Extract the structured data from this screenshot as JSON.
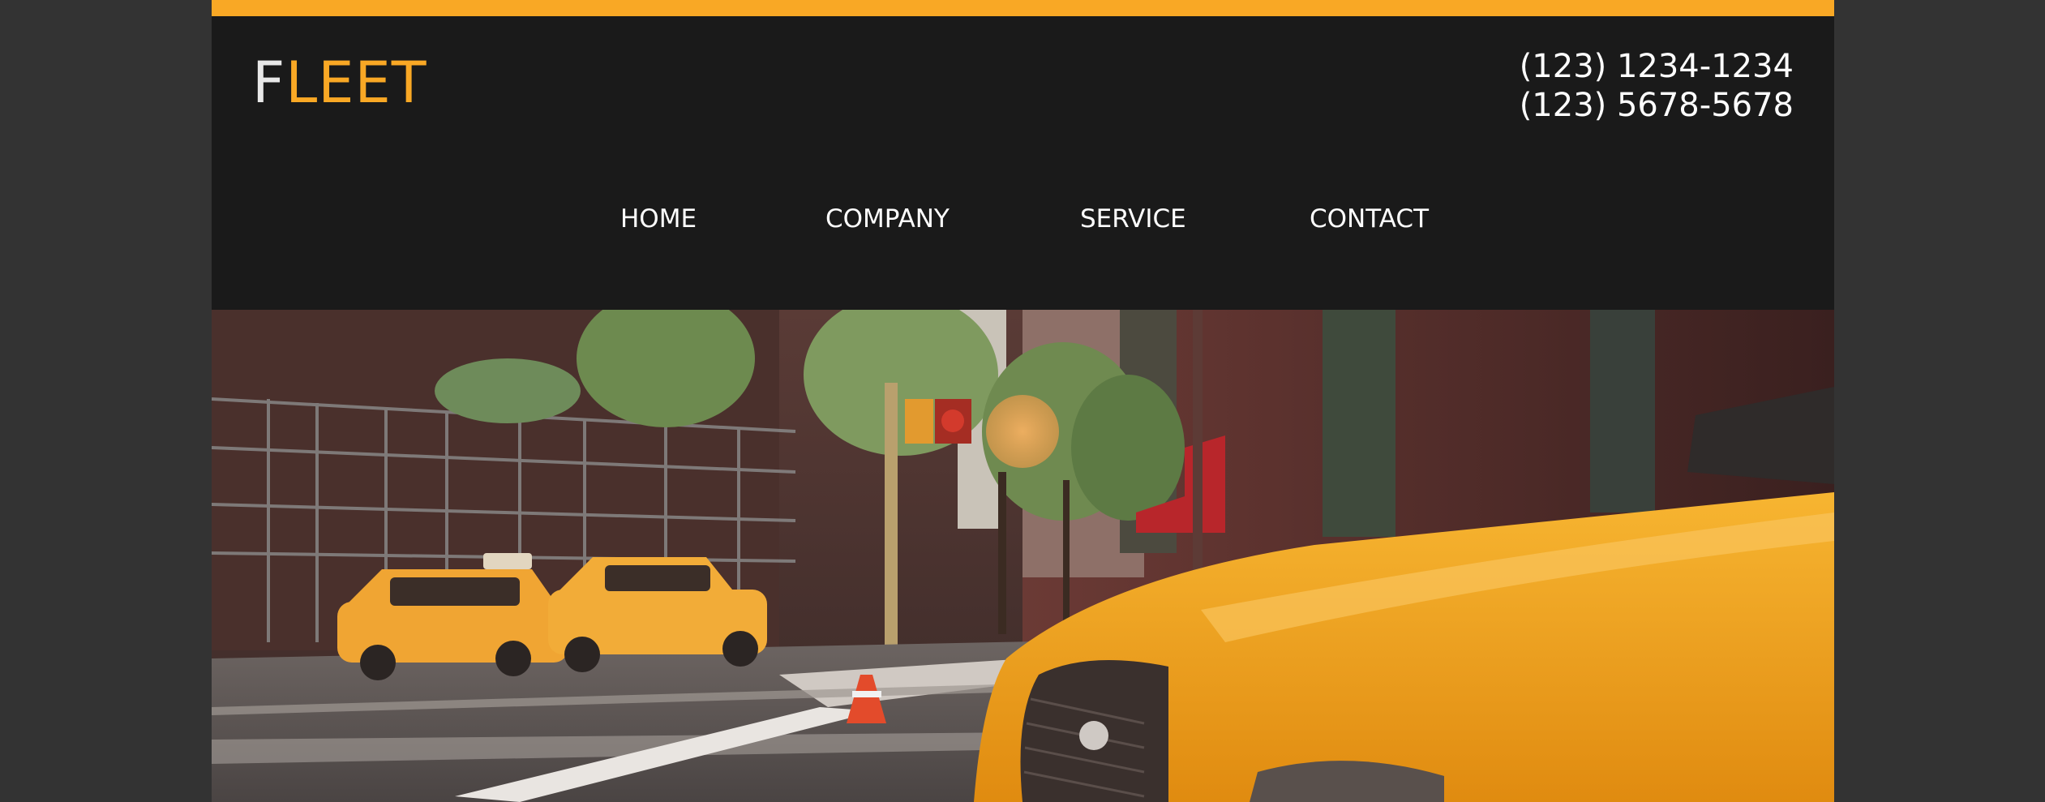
{
  "brand": {
    "first_letter": "F",
    "rest": "LEET",
    "accent_color": "#f9a825",
    "first_letter_color": "#e8e8e8"
  },
  "contact": {
    "phone_1": "(123) 1234-1234",
    "phone_2": "(123) 5678-5678"
  },
  "nav": {
    "items": [
      {
        "label": "HOME"
      },
      {
        "label": "COMPANY"
      },
      {
        "label": "SERVICE"
      },
      {
        "label": "CONTACT"
      }
    ]
  },
  "hero": {
    "image_content": "city-street-taxi-photo"
  },
  "colors": {
    "background": "#333333",
    "page": "#1a1a1a",
    "accent": "#f9a825",
    "text": "#ffffff"
  }
}
